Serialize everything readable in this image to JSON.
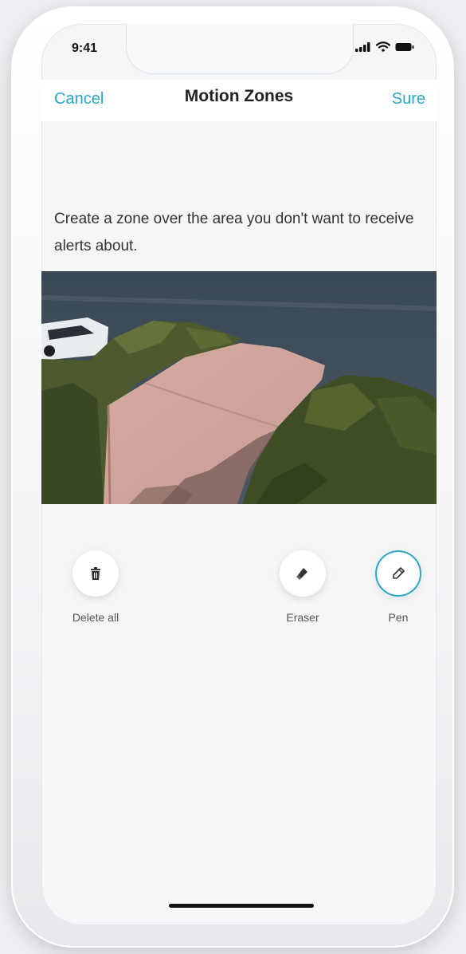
{
  "status_bar": {
    "time": "9:41"
  },
  "nav": {
    "cancel_label": "Cancel",
    "title": "Motion Zones",
    "sure_label": "Sure"
  },
  "instruction": "Create a zone over the area you don't want to receive alerts about.",
  "tools": [
    {
      "label": "Delete all",
      "icon": "trash-icon"
    },
    {
      "label": "Eraser",
      "icon": "eraser-icon"
    },
    {
      "label": "Pen",
      "icon": "pen-icon",
      "selected": true
    }
  ],
  "colors": {
    "accent": "#2aa6c9",
    "background": "#f4f6f8",
    "text": "#333333"
  }
}
